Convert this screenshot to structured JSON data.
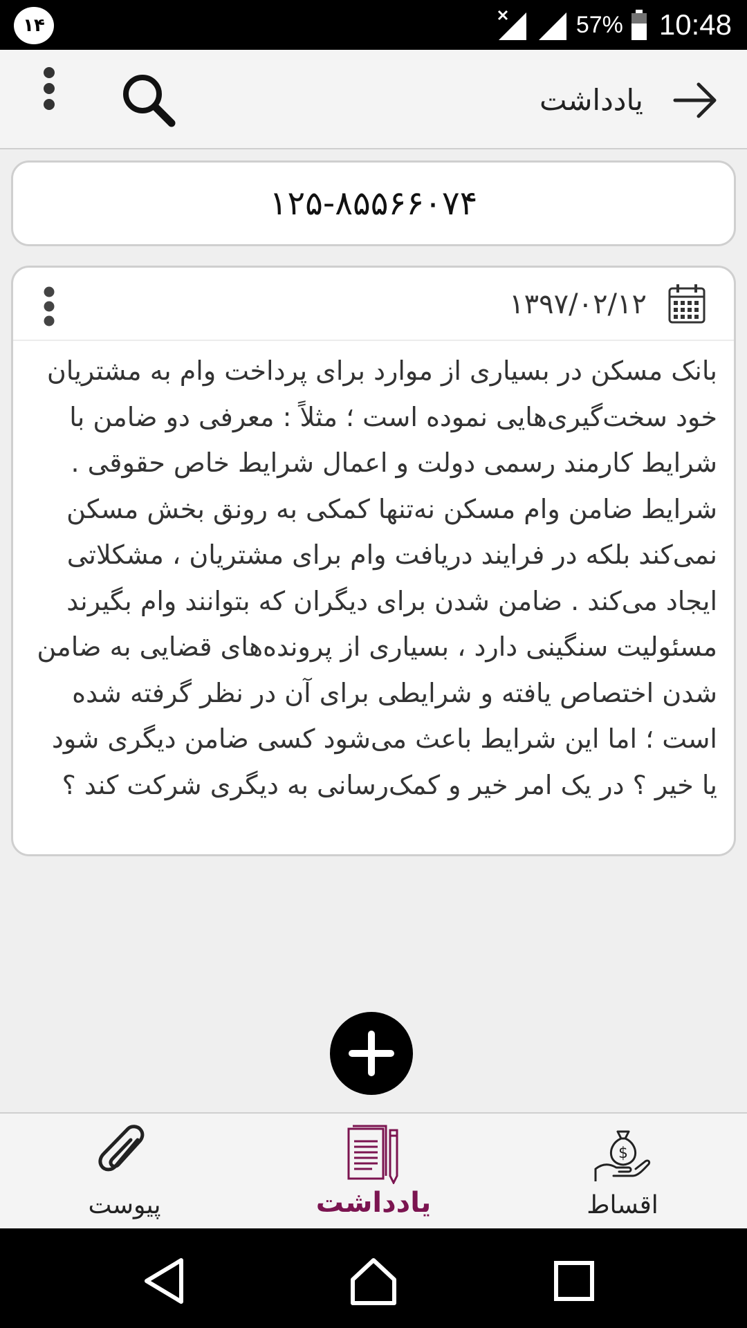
{
  "status_bar": {
    "notification_badge": "۱۴",
    "battery_percent": "57%",
    "time": "10:48"
  },
  "toolbar": {
    "title": "یادداشت",
    "icons": [
      "arrow-right-icon",
      "search-icon",
      "more-vert-icon"
    ]
  },
  "phone_card": {
    "number": "۱۲۵-۸۵۵۶۶۰۷۴"
  },
  "note": {
    "date": "۱۳۹۷/۰۲/۱۲",
    "body": "بانک مسکن در بسیاری از موارد برای پرداخت وام به مشتریان خود سخت‌گیری‌هایی نموده است ؛ مثلاً : معرفی دو ضامن با شرایط کارمند رسمی دولت و اعمال شرایط خاص حقوقی . شرایط ضامن وام مسکن نه‌تنها کمکی به رونق بخش مسکن نمی‌کند بلکه در فرایند دریافت وام برای مشتریان ، مشکلاتی ایجاد می‌کند . ضامن شدن برای دیگران که بتوانند وام بگیرند مسئولیت سنگینی دارد ، بسیاری از پرونده‌های قضایی به ضامن شدن اختصاص یافته و شرایطی برای آن در نظر گرفته شده است ؛ اما این شرایط باعث می‌شود کسی ضامن دیگری شود یا خیر ؟ در یک امر خیر و کمک‌رسانی به دیگری شرکت کند ؟"
  },
  "bottom_nav": {
    "attachment_label": "پیوست",
    "notes_label": "یادداشت",
    "installments_label": "اقساط",
    "active": "notes"
  },
  "colors": {
    "accent": "#7b1450",
    "background": "#efefef",
    "card_border": "#cfcfcf"
  }
}
